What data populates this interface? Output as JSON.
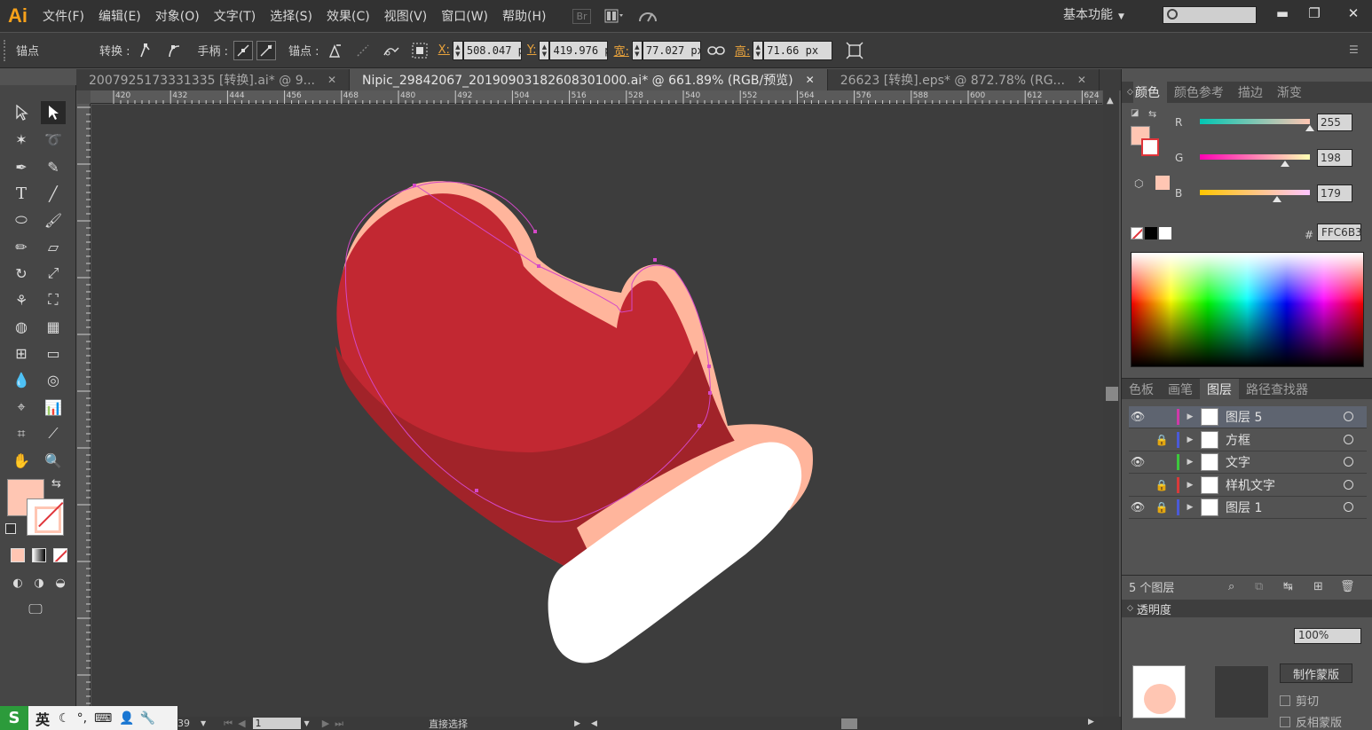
{
  "app": {
    "logo": "Ai"
  },
  "menu": [
    "文件(F)",
    "编辑(E)",
    "对象(O)",
    "文字(T)",
    "选择(S)",
    "效果(C)",
    "视图(V)",
    "窗口(W)",
    "帮助(H)"
  ],
  "menubar": {
    "bridge_label": "Br",
    "workspace": "基本功能"
  },
  "control_bar": {
    "mode_label": "锚点",
    "convert_label": "转换 :",
    "handle_label": "手柄 :",
    "anchor_label": "锚点 :",
    "x_label": "X:",
    "x_value": "508.047 p",
    "y_label": "Y:",
    "y_value": "419.976 p",
    "w_label": "宽:",
    "w_value": "77.027 px",
    "h_label": "高:",
    "h_value": "71.66 px"
  },
  "tabs": [
    {
      "label": "2007925173331335 [转换].ai* @ 9...",
      "active": false
    },
    {
      "label": "Nipic_29842067_20190903182608301000.ai* @ 661.89% (RGB/预览)",
      "active": true
    },
    {
      "label": "26623 [转换].eps* @ 872.78% (RG...",
      "active": false
    }
  ],
  "ruler_ticks": [
    "420",
    "432",
    "444",
    "456",
    "468",
    "480",
    "492",
    "504",
    "516",
    "528",
    "540",
    "552",
    "564",
    "576",
    "588",
    "600",
    "612",
    "624"
  ],
  "color_panel": {
    "tabs": [
      "颜色",
      "颜色参考",
      "描边",
      "渐变"
    ],
    "r_label": "R",
    "r_value": "255",
    "g_label": "G",
    "g_value": "198",
    "b_label": "B",
    "b_value": "179",
    "hex_label": "#",
    "hex_value": "FFC6B3",
    "fill_color": "#ffc6b3",
    "r_fraction": 1.0,
    "g_fraction": 0.776,
    "b_fraction": 0.702
  },
  "layers_panel": {
    "tabs": [
      "色板",
      "画笔",
      "图层",
      "路径查找器"
    ],
    "layers": [
      {
        "name": "图层 5",
        "visible": true,
        "locked": false,
        "color": "#cf3aa8",
        "selected": true
      },
      {
        "name": "方框",
        "visible": false,
        "locked": true,
        "color": "#4a5ad8",
        "selected": false
      },
      {
        "name": "文字",
        "visible": true,
        "locked": false,
        "color": "#3cc83c",
        "selected": false
      },
      {
        "name": "样机文字",
        "visible": false,
        "locked": true,
        "color": "#d83a3a",
        "selected": false
      },
      {
        "name": "图层 1",
        "visible": true,
        "locked": true,
        "color": "#4a5ad8",
        "selected": false
      }
    ],
    "count_label": "5 个图层"
  },
  "transparency_panel": {
    "title": "透明度",
    "opacity": "100%",
    "make_mask": "制作蒙版",
    "clip": "剪切",
    "invert": "反相蒙版"
  },
  "status_bar": {
    "page": "1",
    "tool": "直接选择",
    "zoom_partial": "39"
  },
  "ime": {
    "logo": "S",
    "lang": "英"
  },
  "artwork": {
    "mitten_color": "#c22832",
    "mitten_shadow": "#a12329",
    "outline_color": "#ffb59c",
    "cuff_color": "#ffffff",
    "path_color": "#d448c8"
  }
}
